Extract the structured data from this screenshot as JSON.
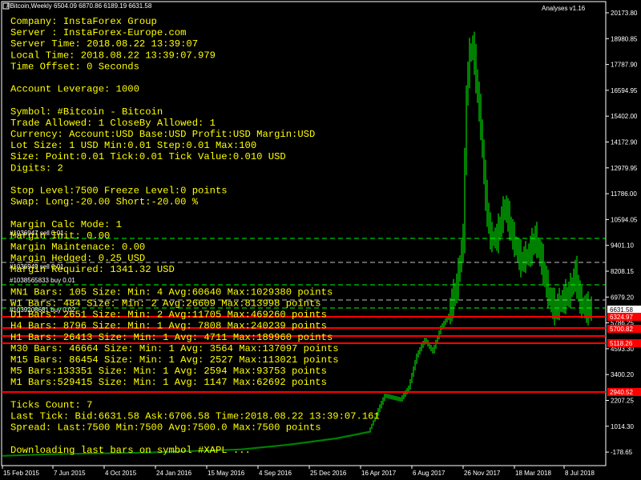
{
  "header": {
    "chart_title": "#Bitcoin,Weekly  6504.09 6870.86 6189.19 6631.58",
    "indicator_label": "Analyses v1.16"
  },
  "info": {
    "lines": [
      "Company: InstaForex Group",
      "Server : InstaForex-Europe.com",
      "Server Time: 2018.08.22 13:39:07",
      "Local  Time: 2018.08.22 13:39:07.979",
      "Time Offset: 0 Seconds",
      "",
      "Account Leverage: 1000",
      "",
      "Symbol: #Bitcoin - Bitcoin",
      "Trade Allowed: 1 CloseBy Allowed: 1",
      "Currency: Account:USD Base:USD Profit:USD Margin:USD",
      "Lot Size: 1 USD Min:0.01 Step:0.01 Max:100",
      "Size: Point:0.01 Tick:0.01 Tick Value:0.010 USD",
      "Digits: 2",
      "",
      "Stop Level:7500 Freeze Level:0 points",
      "Swap: Long:-20.00 Short:-20.00 %",
      "",
      "Margin Calc Mode: 1",
      "Margin Init: 0.00",
      "Margin Maintenace: 0.00",
      "Margin Hedged: 0.25 USD",
      "Margin Required: 1341.32 USD",
      "",
      "MN1 Bars:   105 Size: Min:   4 Avg:60640 Max:1029380 points",
      "W1  Bars:   484 Size: Min:   2 Avg:26609 Max:813998 points",
      "D1  Bars:  2651 Size: Min:   2 Avg:11705 Max:469260 points",
      "H4  Bars:  8796 Size: Min:   1 Avg: 7808 Max:240239 points",
      "H1  Bars: 26413 Size: Min:   1 Avg: 4711 Max:189960 points",
      "M30 Bars: 46664 Size: Min:   1 Avg: 3564 Max:137097 points",
      "M15 Bars: 86454 Size: Min:   1 Avg: 2527 Max:113021 points",
      "M5  Bars:133351 Size: Min:   1 Avg: 2594 Max:93753 points",
      "M1  Bars:529415 Size: Min:   1 Avg: 1147 Max:62692 points",
      "",
      "Ticks Count: 7",
      "Last Tick: Bid:6631.58 Ask:6706.58 Time:2018.08.22 13:39:07.161",
      "Spread: Last:7500 Min:7500 Avg:7500.0 Max:7500 points",
      "",
      "Downloading last bars on symbol #XAPL ..."
    ]
  },
  "order_labels": [
    "#1036947 sell 0.01",
    "#1036949 sell 0.01",
    "#1038565833 buy 0.01",
    "#1039208681 buy 0.02"
  ],
  "y_axis": {
    "labels": [
      "20173.80",
      "18980.85",
      "17787.90",
      "16594.95",
      "15402.00",
      "14172.90",
      "12979.95",
      "11786.00",
      "10594.05",
      "9401.10",
      "8208.15",
      "6979.20",
      "5786.25",
      "4593.30",
      "3400.20",
      "2207.25",
      "1014.30",
      "-178.65"
    ],
    "price_tags": [
      {
        "text": "6631.58",
        "bg": "#ffffff",
        "fg": "#000000"
      },
      {
        "text": "6324.97",
        "bg": "#ff0000",
        "fg": "#ffffff"
      },
      {
        "text": "5700.82",
        "bg": "#ff0000",
        "fg": "#ffffff"
      },
      {
        "text": "5118.26",
        "bg": "#ff0000",
        "fg": "#ffffff"
      },
      {
        "text": "2940.52",
        "bg": "#ff0000",
        "fg": "#ffffff"
      }
    ]
  },
  "x_axis": {
    "labels": [
      "15 Feb 2015",
      "7 Jun 2015",
      "4 Oct 2015",
      "24 Jan 2016",
      "15 May 2016",
      "4 Sep 2016",
      "25 Dec 2016",
      "16 Apr 2017",
      "6 Aug 2017",
      "26 Nov 2017",
      "18 Mar 2018",
      "8 Jul 2018"
    ]
  },
  "colors": {
    "background": "#000000",
    "candle": "#00ff00",
    "text": "#ffff00",
    "level_line": "#ff0000",
    "grid": "#c0c0c0"
  }
}
